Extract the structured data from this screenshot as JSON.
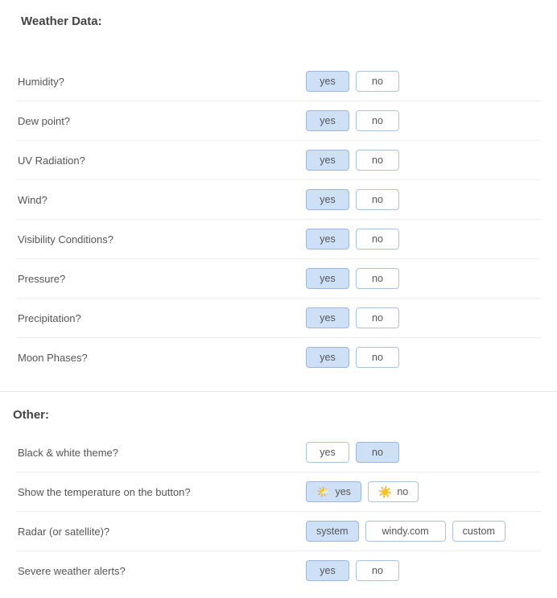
{
  "labels": {
    "yes": "yes",
    "no": "no"
  },
  "weather": {
    "heading": "Weather Data:",
    "items": {
      "humidity": {
        "label": "Humidity?",
        "selected": "yes"
      },
      "dewpoint": {
        "label": "Dew point?",
        "selected": "yes"
      },
      "uv": {
        "label": "UV Radiation?",
        "selected": "yes"
      },
      "wind": {
        "label": "Wind?",
        "selected": "yes"
      },
      "visibility": {
        "label": "Visibility Conditions?",
        "selected": "yes"
      },
      "pressure": {
        "label": "Pressure?",
        "selected": "yes"
      },
      "precipitation": {
        "label": "Precipitation?",
        "selected": "yes"
      },
      "moon": {
        "label": "Moon Phases?",
        "selected": "yes"
      }
    }
  },
  "other": {
    "heading": "Other:",
    "bw_theme": {
      "label": "Black & white theme?",
      "selected": "no"
    },
    "temp_on_button": {
      "label": "Show the temperature on the button?",
      "selected": "yes"
    },
    "radar": {
      "label": "Radar (or satellite)?",
      "options": {
        "system": "system",
        "windy": "windy.com",
        "custom": "custom"
      },
      "selected": "system"
    },
    "alerts": {
      "label": "Severe weather alerts?",
      "selected": "yes"
    }
  }
}
